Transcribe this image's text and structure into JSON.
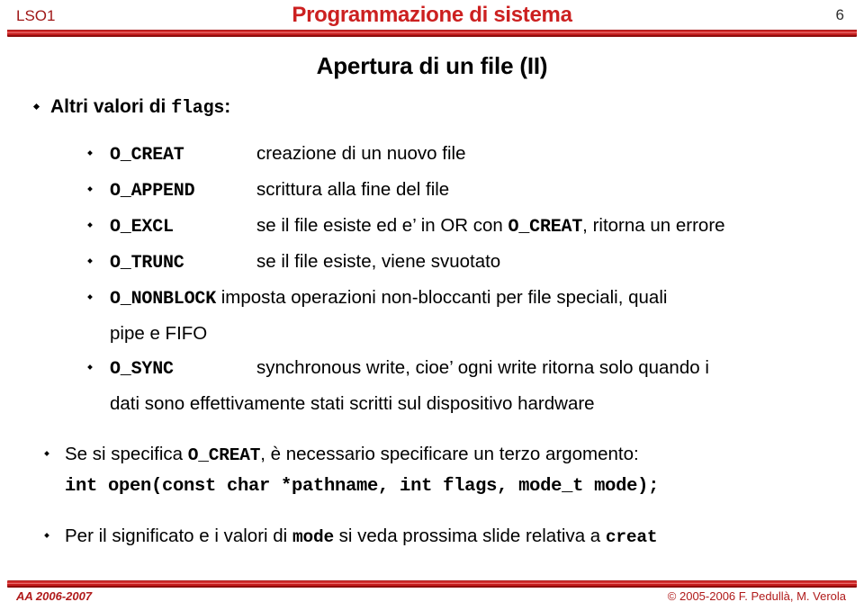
{
  "header": {
    "course_code": "LSO1",
    "title": "Programmazione di sistema",
    "page_number": "6"
  },
  "slide": {
    "title": "Apertura di un file (II)",
    "intro": {
      "text_before": "Altri valori di ",
      "code": "flags",
      "text_after": ":"
    },
    "flags": [
      {
        "name": "O_CREAT",
        "desc": "creazione di un nuovo file"
      },
      {
        "name": "O_APPEND",
        "desc": "scrittura alla fine del file"
      },
      {
        "name": "O_EXCL",
        "desc_before": "se il file esiste ed e’ in OR con ",
        "desc_code": "O_CREAT",
        "desc_after": ", ritorna un errore"
      },
      {
        "name": "O_TRUNC",
        "desc": "se il file esiste, viene svuotato"
      },
      {
        "name": "O_NONBLOCK",
        "desc": "imposta operazioni non-bloccanti per file speciali, quali",
        "continuation": "pipe e FIFO"
      },
      {
        "name": "O_SYNC",
        "desc": "synchronous write, cioe’ ogni write ritorna solo quando i",
        "continuation": "dati sono effettivamente stati scritti sul dispositivo hardware"
      }
    ],
    "note_creat": {
      "text_before": "Se si specifica ",
      "code": "O_CREAT",
      "text_after": ", è necessario specificare un terzo argomento:"
    },
    "signature": "int open(const char *pathname, int flags, mode_t mode);",
    "note_mode": {
      "text_before": "Per il significato e i valori di ",
      "code1": "mode",
      "text_middle": " si veda prossima slide relativa a ",
      "code2": "creat"
    }
  },
  "footer": {
    "academic_year": "AA 2006-2007",
    "copyright": "© 2005-2006 F. Pedullà, M. Verola"
  },
  "colors": {
    "accent_red": "#CC2020",
    "header_code_red": "#A01818",
    "footer_red": "#B01A1A"
  }
}
